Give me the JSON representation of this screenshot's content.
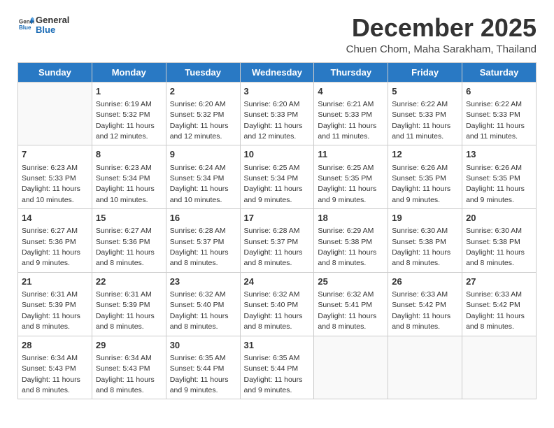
{
  "logo": {
    "general": "General",
    "blue": "Blue"
  },
  "title": "December 2025",
  "subtitle": "Chuen Chom, Maha Sarakham, Thailand",
  "days_of_week": [
    "Sunday",
    "Monday",
    "Tuesday",
    "Wednesday",
    "Thursday",
    "Friday",
    "Saturday"
  ],
  "weeks": [
    [
      {
        "day": "",
        "sunrise": "",
        "sunset": "",
        "daylight": ""
      },
      {
        "day": "1",
        "sunrise": "6:19 AM",
        "sunset": "5:32 PM",
        "daylight": "11 hours and 12 minutes."
      },
      {
        "day": "2",
        "sunrise": "6:20 AM",
        "sunset": "5:32 PM",
        "daylight": "11 hours and 12 minutes."
      },
      {
        "day": "3",
        "sunrise": "6:20 AM",
        "sunset": "5:33 PM",
        "daylight": "11 hours and 12 minutes."
      },
      {
        "day": "4",
        "sunrise": "6:21 AM",
        "sunset": "5:33 PM",
        "daylight": "11 hours and 11 minutes."
      },
      {
        "day": "5",
        "sunrise": "6:22 AM",
        "sunset": "5:33 PM",
        "daylight": "11 hours and 11 minutes."
      },
      {
        "day": "6",
        "sunrise": "6:22 AM",
        "sunset": "5:33 PM",
        "daylight": "11 hours and 11 minutes."
      }
    ],
    [
      {
        "day": "7",
        "sunrise": "6:23 AM",
        "sunset": "5:33 PM",
        "daylight": "11 hours and 10 minutes."
      },
      {
        "day": "8",
        "sunrise": "6:23 AM",
        "sunset": "5:34 PM",
        "daylight": "11 hours and 10 minutes."
      },
      {
        "day": "9",
        "sunrise": "6:24 AM",
        "sunset": "5:34 PM",
        "daylight": "11 hours and 10 minutes."
      },
      {
        "day": "10",
        "sunrise": "6:25 AM",
        "sunset": "5:34 PM",
        "daylight": "11 hours and 9 minutes."
      },
      {
        "day": "11",
        "sunrise": "6:25 AM",
        "sunset": "5:35 PM",
        "daylight": "11 hours and 9 minutes."
      },
      {
        "day": "12",
        "sunrise": "6:26 AM",
        "sunset": "5:35 PM",
        "daylight": "11 hours and 9 minutes."
      },
      {
        "day": "13",
        "sunrise": "6:26 AM",
        "sunset": "5:35 PM",
        "daylight": "11 hours and 9 minutes."
      }
    ],
    [
      {
        "day": "14",
        "sunrise": "6:27 AM",
        "sunset": "5:36 PM",
        "daylight": "11 hours and 9 minutes."
      },
      {
        "day": "15",
        "sunrise": "6:27 AM",
        "sunset": "5:36 PM",
        "daylight": "11 hours and 8 minutes."
      },
      {
        "day": "16",
        "sunrise": "6:28 AM",
        "sunset": "5:37 PM",
        "daylight": "11 hours and 8 minutes."
      },
      {
        "day": "17",
        "sunrise": "6:28 AM",
        "sunset": "5:37 PM",
        "daylight": "11 hours and 8 minutes."
      },
      {
        "day": "18",
        "sunrise": "6:29 AM",
        "sunset": "5:38 PM",
        "daylight": "11 hours and 8 minutes."
      },
      {
        "day": "19",
        "sunrise": "6:30 AM",
        "sunset": "5:38 PM",
        "daylight": "11 hours and 8 minutes."
      },
      {
        "day": "20",
        "sunrise": "6:30 AM",
        "sunset": "5:38 PM",
        "daylight": "11 hours and 8 minutes."
      }
    ],
    [
      {
        "day": "21",
        "sunrise": "6:31 AM",
        "sunset": "5:39 PM",
        "daylight": "11 hours and 8 minutes."
      },
      {
        "day": "22",
        "sunrise": "6:31 AM",
        "sunset": "5:39 PM",
        "daylight": "11 hours and 8 minutes."
      },
      {
        "day": "23",
        "sunrise": "6:32 AM",
        "sunset": "5:40 PM",
        "daylight": "11 hours and 8 minutes."
      },
      {
        "day": "24",
        "sunrise": "6:32 AM",
        "sunset": "5:40 PM",
        "daylight": "11 hours and 8 minutes."
      },
      {
        "day": "25",
        "sunrise": "6:32 AM",
        "sunset": "5:41 PM",
        "daylight": "11 hours and 8 minutes."
      },
      {
        "day": "26",
        "sunrise": "6:33 AM",
        "sunset": "5:42 PM",
        "daylight": "11 hours and 8 minutes."
      },
      {
        "day": "27",
        "sunrise": "6:33 AM",
        "sunset": "5:42 PM",
        "daylight": "11 hours and 8 minutes."
      }
    ],
    [
      {
        "day": "28",
        "sunrise": "6:34 AM",
        "sunset": "5:43 PM",
        "daylight": "11 hours and 8 minutes."
      },
      {
        "day": "29",
        "sunrise": "6:34 AM",
        "sunset": "5:43 PM",
        "daylight": "11 hours and 8 minutes."
      },
      {
        "day": "30",
        "sunrise": "6:35 AM",
        "sunset": "5:44 PM",
        "daylight": "11 hours and 9 minutes."
      },
      {
        "day": "31",
        "sunrise": "6:35 AM",
        "sunset": "5:44 PM",
        "daylight": "11 hours and 9 minutes."
      },
      {
        "day": "",
        "sunrise": "",
        "sunset": "",
        "daylight": ""
      },
      {
        "day": "",
        "sunrise": "",
        "sunset": "",
        "daylight": ""
      },
      {
        "day": "",
        "sunrise": "",
        "sunset": "",
        "daylight": ""
      }
    ]
  ]
}
